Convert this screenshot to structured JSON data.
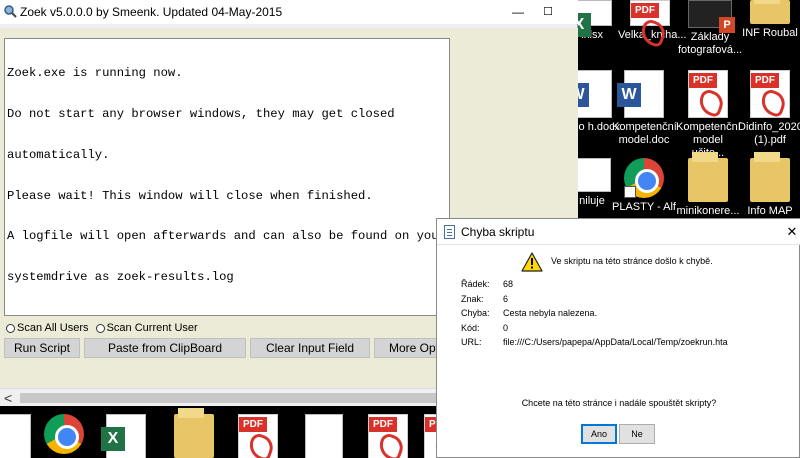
{
  "zoek": {
    "title": "Zoek v5.0.0.0 by Smeenk. Updated 04-May-2015",
    "output_lines": [
      "Zoek.exe is running now.",
      "Do not start any browser windows, they may get closed",
      "automatically.",
      "Please wait! This window will close when finished.",
      "A logfile will open afterwards and can also be found on your",
      "systemdrive as zoek-results.log"
    ],
    "radios": [
      "Scan All Users",
      "Scan Current User"
    ],
    "buttons": [
      "Run Script",
      "Paste from ClipBoard",
      "Clear Input Field",
      "More Opt"
    ],
    "scroll_left_glyph": "<"
  },
  "dialog": {
    "title": "Chyba skriptu",
    "close_glyph": "✕",
    "message": "Ve skriptu na této stránce došlo k chybě.",
    "fields": [
      {
        "label": "Řádek:",
        "value": "68"
      },
      {
        "label": "Znak:",
        "value": "6"
      },
      {
        "label": "Chyba:",
        "value": "Cesta nebyla nalezena."
      },
      {
        "label": "Kód:",
        "value": "0"
      },
      {
        "label": "URL:",
        "value": "file:///C:/Users/papepa/AppData/Local/Temp/zoekrun.hta"
      }
    ],
    "question": "Chcete na této stránce i nadále spouštět skripty?",
    "yes_label": "Ano",
    "no_label": "Ne"
  },
  "desktop": {
    "row1": [
      {
        "label": ".xlsx",
        "icon": "excel-icon"
      },
      {
        "label": "Velka_kniha...",
        "icon": "pdf-icon"
      },
      {
        "label": "Základy fotografová...",
        "icon": "powerpoint-icon"
      },
      {
        "label": "INF Roubal",
        "icon": "folder-icon"
      }
    ],
    "row2": [
      {
        "label": "ny o h.docx",
        "icon": "word-icon"
      },
      {
        "label": "Kompetenční model.doc",
        "icon": "word-icon"
      },
      {
        "label": "Kompetenční model učite...",
        "icon": "pdf-icon"
      },
      {
        "label": "Didinfo_2020 (1).pdf",
        "icon": "pdf-icon"
      }
    ],
    "row3": [
      {
        "label": "niluje",
        "icon": "document-icon"
      },
      {
        "label": "PLASTY - Alf",
        "icon": "chrome-icon"
      },
      {
        "label": "minikonere...",
        "icon": "folder-icon"
      },
      {
        "label": "Info MAP",
        "icon": "folder-icon"
      }
    ],
    "bottom_row_icons": [
      "document-icon",
      "chrome-icon",
      "excel-icon",
      "folder-icon",
      "pdf-icon",
      "pdf-icon",
      "document-icon",
      "pdf-icon",
      "pdf-icon"
    ]
  }
}
